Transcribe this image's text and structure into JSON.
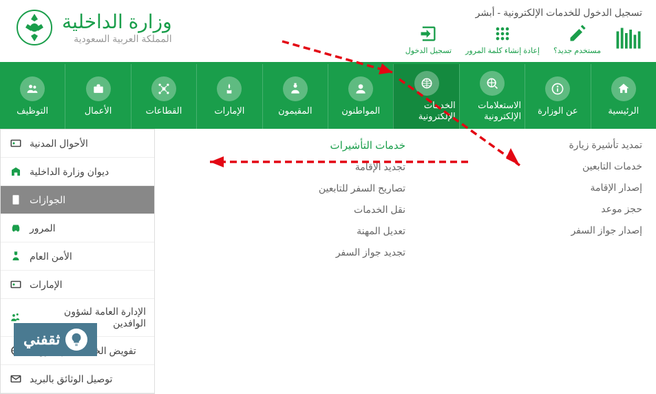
{
  "header": {
    "ministry_title": "وزارة الداخلية",
    "ministry_subtitle": "المملكة العربية السعودية",
    "absher_title": "تسجيل الدخول للخدمات الإلكترونية - أبشر",
    "absher_actions": [
      {
        "label": "مستخدم جديد؟"
      },
      {
        "label": "إعادة إنشاء كلمة المرور"
      },
      {
        "label": "تسجيل الدخول"
      }
    ]
  },
  "nav": [
    {
      "label": "الرئيسية",
      "icon": "home"
    },
    {
      "label": "عن الوزارة",
      "icon": "info"
    },
    {
      "label": "الاستعلامات الإلكترونية",
      "icon": "globe-search"
    },
    {
      "label": "الخدمات الإلكترونية",
      "icon": "globe",
      "active": true
    },
    {
      "label": "المواطنون",
      "icon": "person"
    },
    {
      "label": "المقيمون",
      "icon": "person2"
    },
    {
      "label": "الإمارات",
      "icon": "emirates"
    },
    {
      "label": "القطاعات",
      "icon": "sectors"
    },
    {
      "label": "الأعمال",
      "icon": "briefcase"
    },
    {
      "label": "التوظيف",
      "icon": "jobs"
    }
  ],
  "sidebar": [
    {
      "label": "الأحوال المدنية",
      "icon": "id"
    },
    {
      "label": "ديوان وزارة الداخلية",
      "icon": "building"
    },
    {
      "label": "الجوازات",
      "icon": "passport",
      "active": true
    },
    {
      "label": "المرور",
      "icon": "car"
    },
    {
      "label": "الأمن العام",
      "icon": "police"
    },
    {
      "label": "الإمارات",
      "icon": "emirates"
    },
    {
      "label": "الإدارة العامة لشؤون الوافدين",
      "icon": "visitors"
    },
    {
      "label": "تفويض الخدمات الإلكترونية",
      "icon": "globe2"
    },
    {
      "label": "توصيل الوثائق بالبريد",
      "icon": "mail"
    }
  ],
  "panel": {
    "col1_title": "خدمات التأشيرات",
    "col1": [
      "تجديد الإقامة",
      "تصاريح السفر للتابعين",
      "نقل الخدمات",
      "تعديل المهنة",
      "تجديد جواز السفر"
    ],
    "col2": [
      "تمديد تأشيرة زيارة",
      "خدمات التابعين",
      "إصدار الإقامة",
      "حجز موعد",
      "إصدار جواز السفر"
    ]
  },
  "logo": {
    "text": "ثقفني"
  }
}
